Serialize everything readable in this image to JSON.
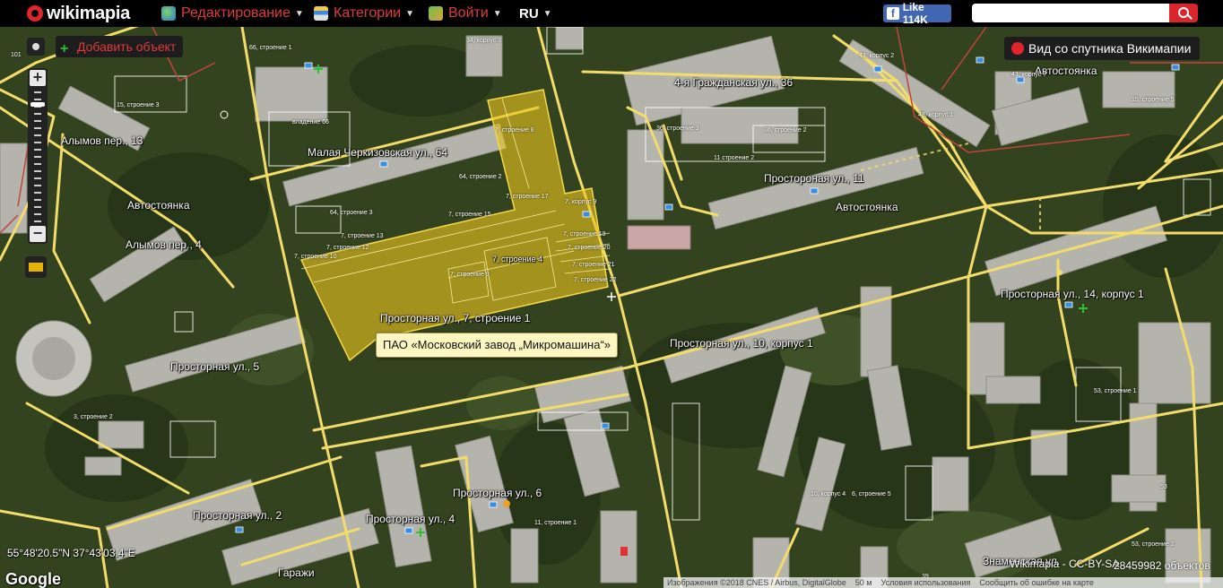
{
  "topbar": {
    "logo": "wikimapia",
    "menu": [
      {
        "label": "Редактирование",
        "icon": "globe-edit-icon"
      },
      {
        "label": "Категории",
        "icon": "categories-icon"
      },
      {
        "label": "Войти",
        "icon": "login-icon"
      }
    ],
    "language": "RU",
    "fb_like": "Like 114K",
    "search_value": "",
    "colors": {
      "bar": "#000000",
      "menu_text": "#e03a3a",
      "search_button": "#d9262d"
    }
  },
  "controls": {
    "add_object": "Добавить объект",
    "satellite_view": "Вид со спутника Викимапии",
    "zoom_in": "+",
    "zoom_out": "−"
  },
  "map": {
    "highlight_color": "#e8c31f",
    "tooltip": "ПАО «Московский завод „Микромашина“»",
    "labels": [
      {
        "text": "Алымов пер., 13",
        "size": "big"
      },
      {
        "text": "Автостоянка",
        "size": "big"
      },
      {
        "text": "Алымов пер., 4",
        "size": "big"
      },
      {
        "text": "Малая Черкизовская ул., 64",
        "size": "big"
      },
      {
        "text": "4-я Гражданская ул., 36",
        "size": "big"
      },
      {
        "text": "Простороная ул., 11",
        "size": "big"
      },
      {
        "text": "Автостоянка",
        "size": "big"
      },
      {
        "text": "Автостоянка",
        "size": "big"
      },
      {
        "text": "Просторная ул., 14, корпус 1",
        "size": "big"
      },
      {
        "text": "Просторная ул., 7, строение 1",
        "size": "big"
      },
      {
        "text": "Просторная ул., 10, корпус 1",
        "size": "big"
      },
      {
        "text": "Просторная ул., 5",
        "size": "big"
      },
      {
        "text": "Просторная ул., 6",
        "size": "big"
      },
      {
        "text": "Просторная ул., 2",
        "size": "big"
      },
      {
        "text": "Просторная ул., 4",
        "size": "big"
      },
      {
        "text": "Гаражи",
        "size": "big"
      },
      {
        "text": "Знаменская ул.",
        "size": "big"
      },
      {
        "text": "7, строение 4",
        "size": "big"
      },
      {
        "text": "7, строение 8",
        "size": "small"
      },
      {
        "text": "7, строение 17",
        "size": "small"
      },
      {
        "text": "7, строение 15",
        "size": "small"
      },
      {
        "text": "7, строение 13",
        "size": "small"
      },
      {
        "text": "7, строение 12",
        "size": "small"
      },
      {
        "text": "7, строение 10",
        "size": "small"
      },
      {
        "text": "7, строение 9",
        "size": "small"
      },
      {
        "text": "7, корпус 9",
        "size": "small"
      },
      {
        "text": "7, строение 19",
        "size": "small"
      },
      {
        "text": "7, строение 20",
        "size": "small"
      },
      {
        "text": "7, строение 21",
        "size": "small"
      },
      {
        "text": "7, строение 22",
        "size": "small"
      },
      {
        "text": "64, строение 2",
        "size": "small"
      },
      {
        "text": "64, строение 3",
        "size": "small"
      },
      {
        "text": "66, строение 1",
        "size": "small"
      },
      {
        "text": "владение 66",
        "size": "small"
      },
      {
        "text": "34, корпус 3",
        "size": "small"
      },
      {
        "text": "15, строение 3",
        "size": "small"
      },
      {
        "text": "36, строение 3",
        "size": "small"
      },
      {
        "text": "36, строение 2",
        "size": "small"
      },
      {
        "text": "11 строение 2",
        "size": "small"
      },
      {
        "text": "43, корпус 2",
        "size": "small"
      },
      {
        "text": "43, корпус 1",
        "size": "small"
      },
      {
        "text": "43, корпус 7",
        "size": "small"
      },
      {
        "text": "15, строение 5",
        "size": "small"
      },
      {
        "text": "53, строение 1",
        "size": "small"
      },
      {
        "text": "3, строение 2",
        "size": "small"
      },
      {
        "text": "11, строение 1",
        "size": "small"
      },
      {
        "text": "10, корпус 4",
        "size": "small"
      },
      {
        "text": "6, строение 5",
        "size": "small"
      },
      {
        "text": "53",
        "size": "small"
      },
      {
        "text": "53, строение 2",
        "size": "small"
      },
      {
        "text": "39",
        "size": "small"
      },
      {
        "text": "101",
        "size": "small"
      }
    ]
  },
  "status": {
    "coordinates": "55°48'20.5\"N 37°43'03.4\"E",
    "google": "Google",
    "wikimapia_license": "Wikimapia - CC-BY-SA",
    "object_count": "28459982 объектов",
    "attribution": [
      "Изображения ©2018 CNES / Airbus, DigitalGlobe",
      "50 м",
      "Условия использования",
      "Сообщить об ошибке на карте"
    ]
  }
}
